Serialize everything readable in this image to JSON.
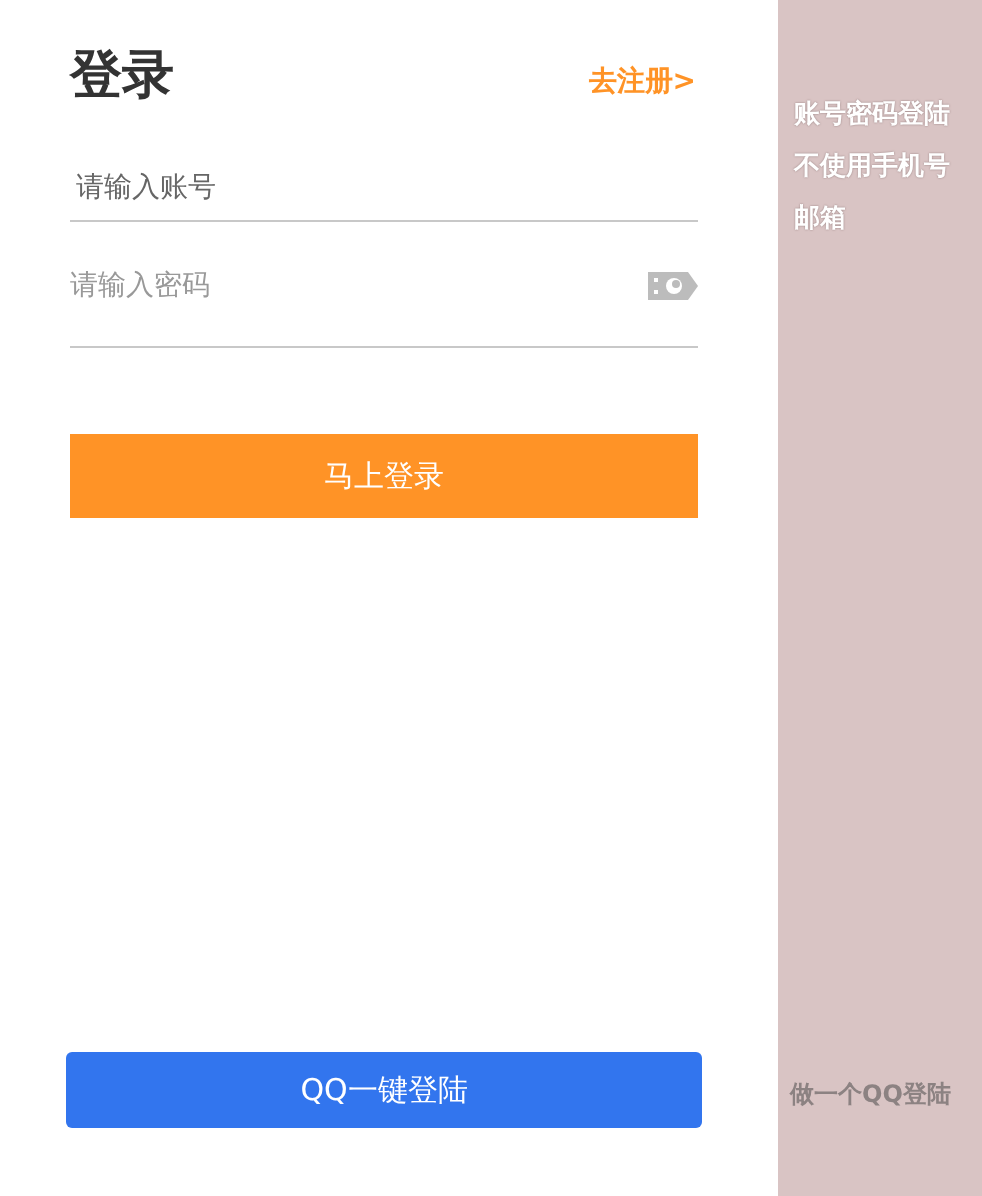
{
  "login": {
    "title": "登录",
    "register_link": "去注册>",
    "account_field": {
      "placeholder": "请输入账号"
    },
    "password_field": {
      "placeholder": "请输入密码"
    },
    "submit_button": "马上登录",
    "qq_button": "QQ一键登陆"
  },
  "notes": {
    "top": [
      "账号密码登陆",
      "不使用手机号",
      "邮箱"
    ],
    "bottom": "做一个QQ登陆"
  }
}
